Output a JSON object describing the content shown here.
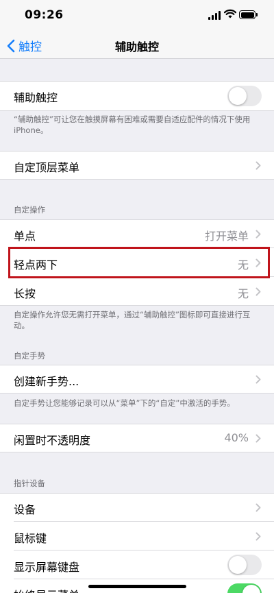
{
  "status": {
    "time": "09:26"
  },
  "nav": {
    "back_label": "触控",
    "title": "辅助触控"
  },
  "assistive": {
    "label": "辅助触控",
    "toggle_on": false,
    "footnote": "“辅助触控”可让您在触摸屏幕有困难或需要自适应配件的情况下使用iPhone。"
  },
  "top_menu": {
    "label": "自定顶层菜单"
  },
  "custom_actions": {
    "header": "自定操作",
    "items": [
      {
        "label": "单点",
        "value": "打开菜单"
      },
      {
        "label": "轻点两下",
        "value": "无"
      },
      {
        "label": "长按",
        "value": "无"
      }
    ],
    "footnote": "自定操作允许您无需打开菜单，通过“辅助触控”图标即可直接进行互动。"
  },
  "custom_gestures": {
    "header": "自定手势",
    "create_label": "创建新手势...",
    "footnote": "自定手势让您能够记录可以从“菜单”下的“自定”中激活的手势。"
  },
  "idle_opacity": {
    "label": "闲置时不透明度",
    "value": "40%"
  },
  "pointer": {
    "header": "指针设备",
    "devices_label": "设备",
    "mouse_keys_label": "鼠标键",
    "onscreen_keyboard_label": "显示屏幕键盘",
    "onscreen_keyboard_on": false,
    "always_show_menu_label": "始终显示菜单",
    "always_show_menu_on": true
  },
  "colors": {
    "accent": "#147efb",
    "toggle_on": "#4cd964",
    "highlight": "#c0141b"
  }
}
